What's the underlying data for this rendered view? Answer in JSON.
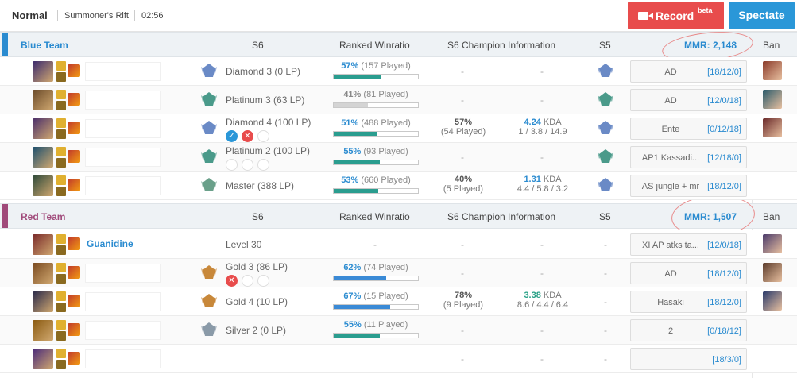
{
  "header": {
    "mode": "Normal",
    "map": "Summoner's Rift",
    "time": "02:56",
    "record_label": "Record",
    "record_badge": "beta",
    "spectate_label": "Spectate"
  },
  "columns": {
    "s6": "S6",
    "winratio": "Ranked Winratio",
    "champ_info": "S6 Champion Information",
    "s5": "S5",
    "ban": "Ban"
  },
  "blue": {
    "name": "Blue Team",
    "mmr": "MMR: 2,148",
    "color": "#2a8bd0",
    "players": [
      {
        "rank": "Diamond 3 (0 LP)",
        "wr_pct": "57%",
        "wr_games": "(157 Played)",
        "wr": 0.57,
        "cwr": "-",
        "cgames": "",
        "kda": "-",
        "kda_line": "",
        "note": "AD",
        "note_kda": "[18/12/0]"
      },
      {
        "rank": "Platinum 3 (63 LP)",
        "wr_pct": "41%",
        "wr_games": "(81 Played)",
        "wr": 0.41,
        "cwr": "-",
        "cgames": "",
        "kda": "-",
        "kda_line": "",
        "note": "AD",
        "note_kda": "[12/0/18]"
      },
      {
        "rank": "Diamond 4 (100 LP)",
        "wr_pct": "51%",
        "wr_games": "(488 Played)",
        "wr": 0.51,
        "cwr": "57%",
        "cgames": "(54 Played)",
        "kda": "4.24",
        "kda_suffix": "KDA",
        "kda_line": "1 / 3.8 / 14.9",
        "note": "Ente",
        "note_kda": "[0/12/18]"
      },
      {
        "rank": "Platinum 2 (100 LP)",
        "wr_pct": "55%",
        "wr_games": "(93 Played)",
        "wr": 0.55,
        "cwr": "-",
        "cgames": "",
        "kda": "-",
        "kda_line": "",
        "note": "AP1 Kassadi...",
        "note_kda": "[12/18/0]"
      },
      {
        "rank": "Master (388 LP)",
        "wr_pct": "53%",
        "wr_games": "(660 Played)",
        "wr": 0.53,
        "cwr": "40%",
        "cgames": "(5 Played)",
        "kda": "1.31",
        "kda_suffix": "KDA",
        "kda_line": "4.4 / 5.8 / 3.2",
        "note": "AS jungle + mr",
        "note_kda": "[18/12/0]"
      }
    ]
  },
  "red": {
    "name": "Red Team",
    "mmr": "MMR: 1,507",
    "color": "#a04a7a",
    "players": [
      {
        "summoner": "Guanidine",
        "rank": "Level 30",
        "wr_pct": "",
        "wr_games": "",
        "cwr": "-",
        "cgames": "",
        "kda": "-",
        "kda_line": "",
        "note": "XI AP atks ta...",
        "note_kda": "[12/0/18]"
      },
      {
        "rank": "Gold 3 (86 LP)",
        "wr_pct": "62%",
        "wr_games": "(74 Played)",
        "wr": 0.62,
        "cwr": "-",
        "cgames": "",
        "kda": "-",
        "kda_line": "",
        "note": "AD",
        "note_kda": "[18/12/0]"
      },
      {
        "rank": "Gold 4 (10 LP)",
        "wr_pct": "67%",
        "wr_games": "(15 Played)",
        "wr": 0.67,
        "cwr": "78%",
        "cgames": "(9 Played)",
        "kda": "3.38",
        "kda_suffix": "KDA",
        "kda_line": "8.6 / 4.4 / 6.4",
        "note": "Hasaki",
        "note_kda": "[18/12/0]"
      },
      {
        "rank": "Silver 2 (0 LP)",
        "wr_pct": "55%",
        "wr_games": "(11 Played)",
        "wr": 0.55,
        "cwr": "-",
        "cgames": "",
        "kda": "-",
        "kda_line": "",
        "note": "2",
        "note_kda": "[0/18/12]"
      },
      {
        "rank": "",
        "wr_pct": "",
        "wr_games": "",
        "cwr": "-",
        "cgames": "",
        "kda": "-",
        "kda_line": "",
        "note": "",
        "note_kda": "[18/3/0]"
      }
    ]
  },
  "dash": "-"
}
